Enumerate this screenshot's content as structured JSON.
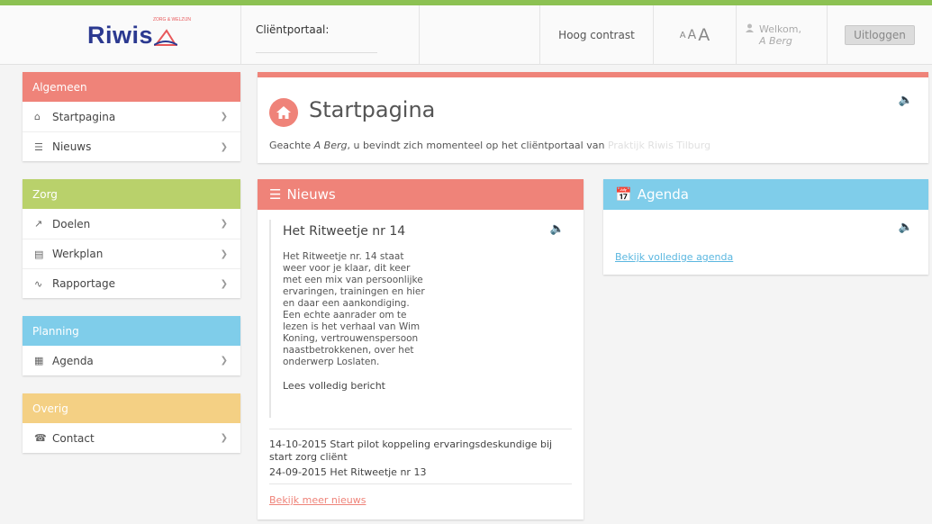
{
  "header": {
    "logo_text": "Riwis",
    "logo_tagline": "ZORG & WELZIJN",
    "portal_label": "Cliëntportaal:",
    "contrast_label": "Hoog contrast",
    "font_small": "A",
    "font_medium": "A",
    "font_large": "A",
    "welcome_label": "Welkom,",
    "user_name": "A Berg",
    "logout_label": "Uitloggen"
  },
  "sidebar": {
    "sections": [
      {
        "title": "Algemeen",
        "color": "#ef8379",
        "items": [
          {
            "label": "Startpagina",
            "icon": "home-icon"
          },
          {
            "label": "Nieuws",
            "icon": "list-icon"
          }
        ]
      },
      {
        "title": "Zorg",
        "color": "#b9d16b",
        "items": [
          {
            "label": "Doelen",
            "icon": "target-icon"
          },
          {
            "label": "Werkplan",
            "icon": "document-icon"
          },
          {
            "label": "Rapportage",
            "icon": "pulse-icon"
          }
        ]
      },
      {
        "title": "Planning",
        "color": "#7fcdea",
        "items": [
          {
            "label": "Agenda",
            "icon": "calendar-icon"
          }
        ]
      },
      {
        "title": "Overig",
        "color": "#f4d084",
        "items": [
          {
            "label": "Contact",
            "icon": "phone-icon"
          }
        ]
      }
    ]
  },
  "start": {
    "title": "Startpagina",
    "greeting_prefix": "Geachte ",
    "greeting_name": "A Berg",
    "greeting_suffix": ", u bevindt zich momenteel op het cliëntportaal van",
    "greeting_faint": "Praktijk Riwis Tilburg"
  },
  "news": {
    "title": "Nieuws",
    "color": "#ef8379",
    "article_title": "Het Ritweetje nr 14",
    "article_body": "Het Ritweetje nr. 14 staat weer voor je klaar, dit keer met een mix van persoonlijke ervaringen, trainingen en hier en daar een aankondiging. Een echte aanrader om te lezen is het verhaal van Wim Koning, vertrouwenspersoon naastbetrokkenen, over het onderwerp Loslaten.",
    "read_more": "Lees volledig bericht",
    "items": [
      "14-10-2015 Start pilot koppeling ervaringsdeskundige bij start zorg cliënt",
      "24-09-2015 Het Ritweetje nr 13"
    ],
    "more_link": "Bekijk meer nieuws"
  },
  "agenda": {
    "title": "Agenda",
    "color": "#7fcdea",
    "link": "Bekijk volledige agenda"
  }
}
